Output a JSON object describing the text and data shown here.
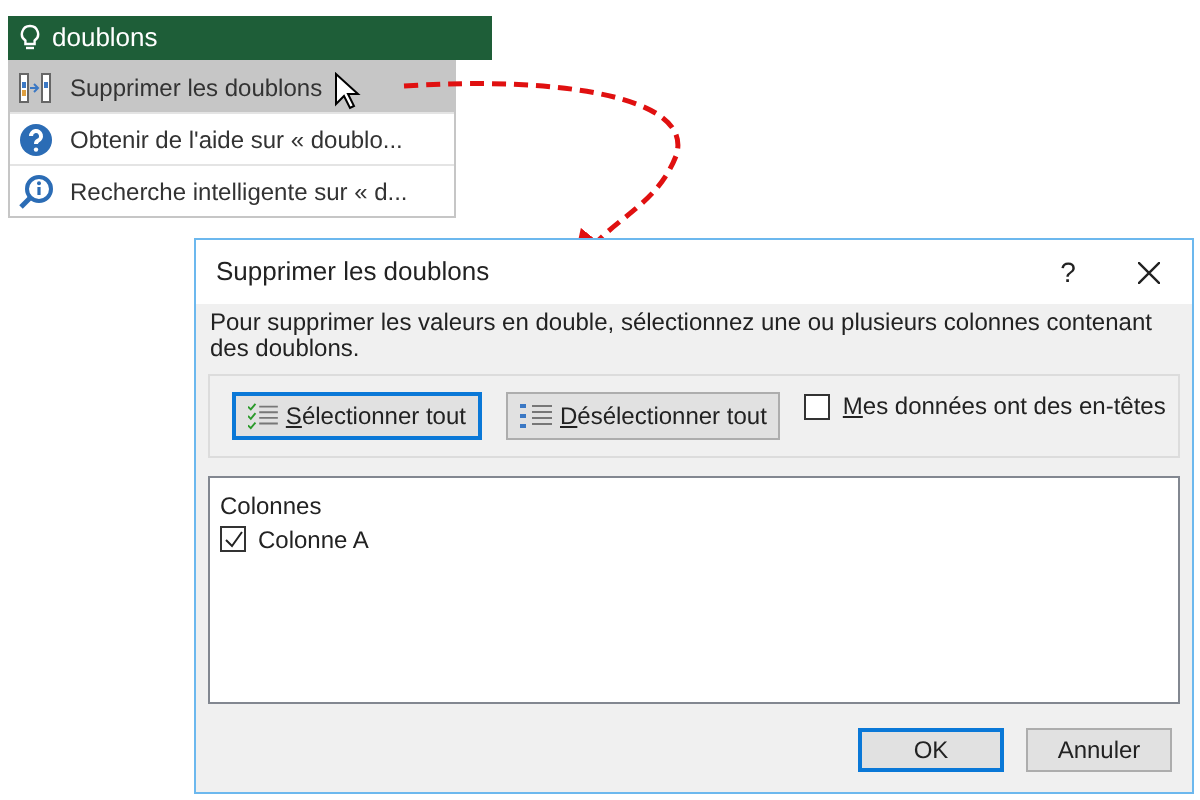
{
  "search_box": {
    "value": "doublons"
  },
  "menu": {
    "items": [
      {
        "kind": "columns",
        "label": "Supprimer les doublons",
        "selected": true
      },
      {
        "kind": "help",
        "label": "Obtenir de l'aide sur « doublo...",
        "selected": false
      },
      {
        "kind": "smart-search",
        "label": "Recherche intelligente sur « d...",
        "selected": false
      }
    ]
  },
  "dialog": {
    "title": "Supprimer les doublons",
    "help": "?",
    "description": "Pour supprimer les valeurs en double, sélectionnez une ou plusieurs colonnes contenant des doublons.",
    "select_all": "Sélectionner tout",
    "deselect_all": "Désélectionner tout",
    "headers_checkbox": {
      "label": "Mes données ont des en-têtes",
      "checked": false
    },
    "list": {
      "header": "Colonnes",
      "items": [
        {
          "label": "Colonne A",
          "checked": true
        }
      ]
    },
    "buttons": [
      {
        "label": "OK",
        "default": true
      },
      {
        "label": "Annuler",
        "default": false
      }
    ]
  }
}
